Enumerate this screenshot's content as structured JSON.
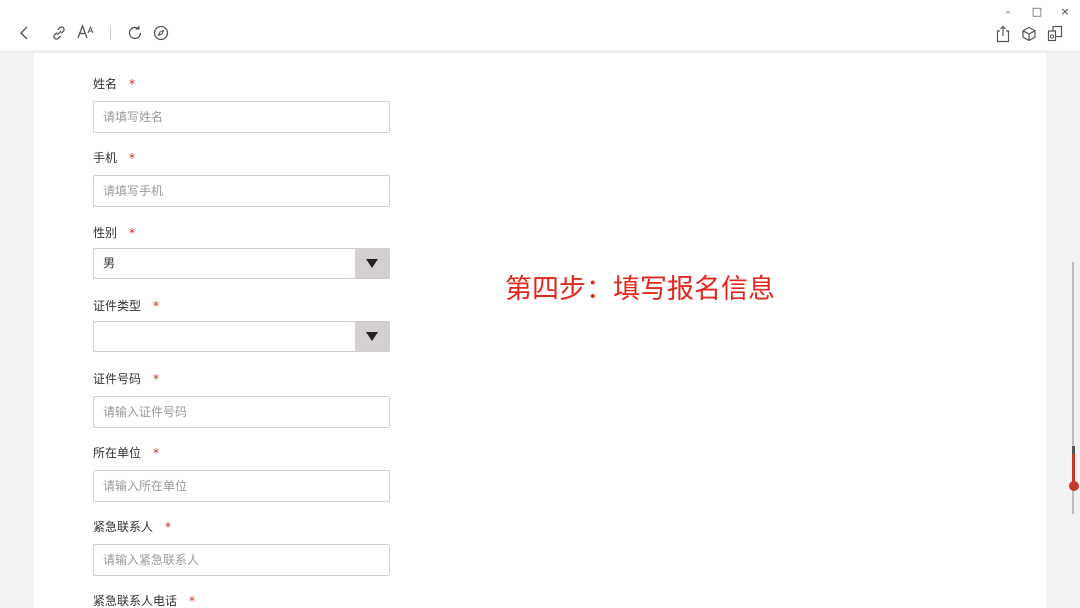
{
  "window": {
    "minimize": "–",
    "maximize": "□",
    "close": "×"
  },
  "toolbar": {
    "icons": [
      "back-icon",
      "link-icon",
      "font-size-icon",
      "refresh-icon",
      "compass-icon",
      "share-icon",
      "cube-icon",
      "copy-icon"
    ]
  },
  "form": {
    "required_mark": "*",
    "fields": [
      {
        "label": "姓名",
        "type": "input",
        "placeholder": "请填写姓名"
      },
      {
        "label": "手机",
        "type": "input",
        "placeholder": "请填写手机"
      },
      {
        "label": "性别",
        "type": "select",
        "value": "男"
      },
      {
        "label": "证件类型",
        "type": "select",
        "value": ""
      },
      {
        "label": "证件号码",
        "type": "input",
        "placeholder": "请输入证件号码"
      },
      {
        "label": "所在单位",
        "type": "input",
        "placeholder": "请输入所在单位"
      },
      {
        "label": "紧急联系人",
        "type": "input",
        "placeholder": "请输入紧急联系人"
      },
      {
        "label": "紧急联系人电话",
        "type": "input",
        "placeholder": ""
      }
    ]
  },
  "annotation": {
    "text": "第四步：填写报名信息",
    "color": "#e0281e"
  },
  "colors": {
    "required": "#d9261c",
    "scroll_accent": "#c0392b"
  }
}
